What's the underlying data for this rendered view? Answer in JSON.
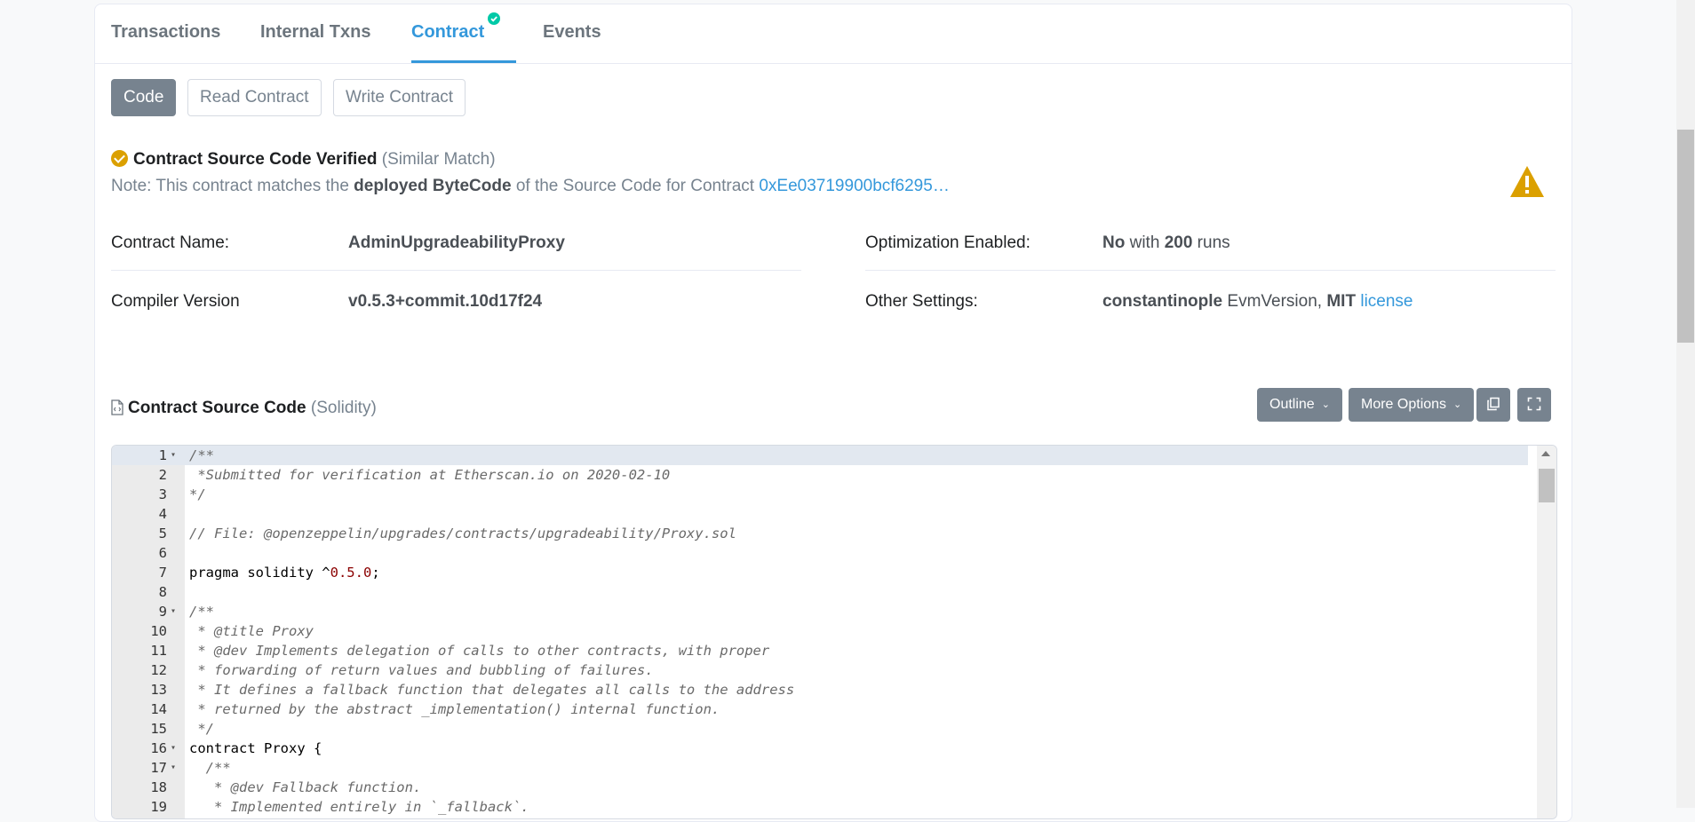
{
  "tabs": [
    {
      "label": "Transactions"
    },
    {
      "label": "Internal Txns"
    },
    {
      "label": "Contract"
    },
    {
      "label": "Events"
    }
  ],
  "subtabs": {
    "code": "Code",
    "read": "Read Contract",
    "write": "Write Contract"
  },
  "verified": {
    "title": "Contract Source Code Verified",
    "match": "(Similar Match)",
    "note_prefix": "Note: This contract matches the ",
    "note_bold": "deployed ByteCode",
    "note_mid": " of the Source Code for Contract ",
    "note_link": "0xEe03719900bcf6295…"
  },
  "info": {
    "name_label": "Contract Name:",
    "name_value": "AdminUpgradeabilityProxy",
    "compiler_label": "Compiler Version",
    "compiler_value": "v0.5.3+commit.10d17f24",
    "opt_label": "Optimization Enabled:",
    "opt_no": "No",
    "opt_with": " with ",
    "opt_runs_num": "200",
    "opt_runs": " runs",
    "other_label": "Other Settings:",
    "other_evm": "constantinople",
    "other_evm_suffix": " EvmVersion, ",
    "other_license": "MIT",
    "other_license_link": "license"
  },
  "source": {
    "title": "Contract Source Code",
    "lang": "(Solidity)",
    "outline_btn": "Outline",
    "more_btn": "More Options"
  },
  "code_lines": [
    {
      "n": "1",
      "fold": true,
      "text": "/**",
      "kind": "cm"
    },
    {
      "n": "2",
      "fold": false,
      "text": " *Submitted for verification at Etherscan.io on 2020-02-10",
      "kind": "cm"
    },
    {
      "n": "3",
      "fold": false,
      "text": "*/",
      "kind": "cm"
    },
    {
      "n": "4",
      "fold": false,
      "text": "",
      "kind": "plain"
    },
    {
      "n": "5",
      "fold": false,
      "text": "// File: @openzeppelin/upgrades/contracts/upgradeability/Proxy.sol",
      "kind": "cm"
    },
    {
      "n": "6",
      "fold": false,
      "text": "",
      "kind": "plain"
    },
    {
      "n": "7",
      "fold": false,
      "text": "pragma solidity ^",
      "num": "0.5.0",
      "after": ";",
      "kind": "pragma"
    },
    {
      "n": "8",
      "fold": false,
      "text": "",
      "kind": "plain"
    },
    {
      "n": "9",
      "fold": true,
      "text": "/**",
      "kind": "cm"
    },
    {
      "n": "10",
      "fold": false,
      "text": " * @title Proxy",
      "kind": "cm"
    },
    {
      "n": "11",
      "fold": false,
      "text": " * @dev Implements delegation of calls to other contracts, with proper",
      "kind": "cm"
    },
    {
      "n": "12",
      "fold": false,
      "text": " * forwarding of return values and bubbling of failures.",
      "kind": "cm"
    },
    {
      "n": "13",
      "fold": false,
      "text": " * It defines a fallback function that delegates all calls to the address",
      "kind": "cm"
    },
    {
      "n": "14",
      "fold": false,
      "text": " * returned by the abstract _implementation() internal function.",
      "kind": "cm"
    },
    {
      "n": "15",
      "fold": false,
      "text": " */",
      "kind": "cm"
    },
    {
      "n": "16",
      "fold": true,
      "text": "contract Proxy {",
      "kind": "plain"
    },
    {
      "n": "17",
      "fold": true,
      "text": "  /**",
      "kind": "cm"
    },
    {
      "n": "18",
      "fold": false,
      "text": "   * @dev Fallback function.",
      "kind": "cm"
    },
    {
      "n": "19",
      "fold": false,
      "text": "   * Implemented entirely in `_fallback`.",
      "kind": "cm"
    }
  ]
}
